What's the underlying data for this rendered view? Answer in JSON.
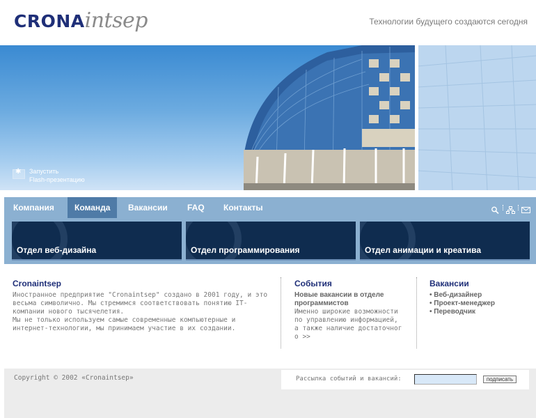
{
  "header": {
    "logo_part1": "CRONA",
    "logo_part2": "intsep",
    "tagline": "Технологии будущего создаются сегодня"
  },
  "hero": {
    "flash_line1": "Запустить",
    "flash_line2": "Flash-презентацию"
  },
  "nav": {
    "items": [
      {
        "label": "Компания"
      },
      {
        "label": "Команда"
      },
      {
        "label": "Вакансии"
      },
      {
        "label": "FAQ"
      },
      {
        "label": "Контакты"
      }
    ],
    "active_index": 1,
    "tools": [
      "search-icon",
      "sitemap-icon",
      "mail-icon"
    ]
  },
  "departments": [
    {
      "label": "Отдел веб-дизайна"
    },
    {
      "label": "Отдел программирования"
    },
    {
      "label": "Отдел анимации и креатива"
    }
  ],
  "about": {
    "title": "Cronaintsep",
    "text": "Иностранное предприятие \"Cronaintsep\" создано в 2001 году, и это весьма символично. Мы стремимся соответствовать понятию IT-компании нового тысячелетия.\nМы не только используем самые современные компьютерные и интернет-технологии, мы принимаем участие в их создании."
  },
  "events": {
    "title": "События",
    "headline": "Новые вакансии в отделе программистов",
    "text": "Именно широкие возможности по управлению информацией, а также наличие достаточного >>"
  },
  "vacancies": {
    "title": "Вакансии",
    "items": [
      "Веб-дизайнер",
      "Проект-менеджер",
      "Переводчик"
    ]
  },
  "footer": {
    "copyright": "Copyright © 2002 «Cronaintsep»",
    "subscribe_label": "Рассылка событий и вакансий:",
    "subscribe_value": "",
    "subscribe_button": "подписать"
  },
  "colors": {
    "brand": "#1f2f78",
    "nav_bg": "#8bb0d1",
    "nav_active": "#4f7ba7",
    "dept_bg": "#0f2c4f",
    "footer_bg": "#ececec"
  }
}
